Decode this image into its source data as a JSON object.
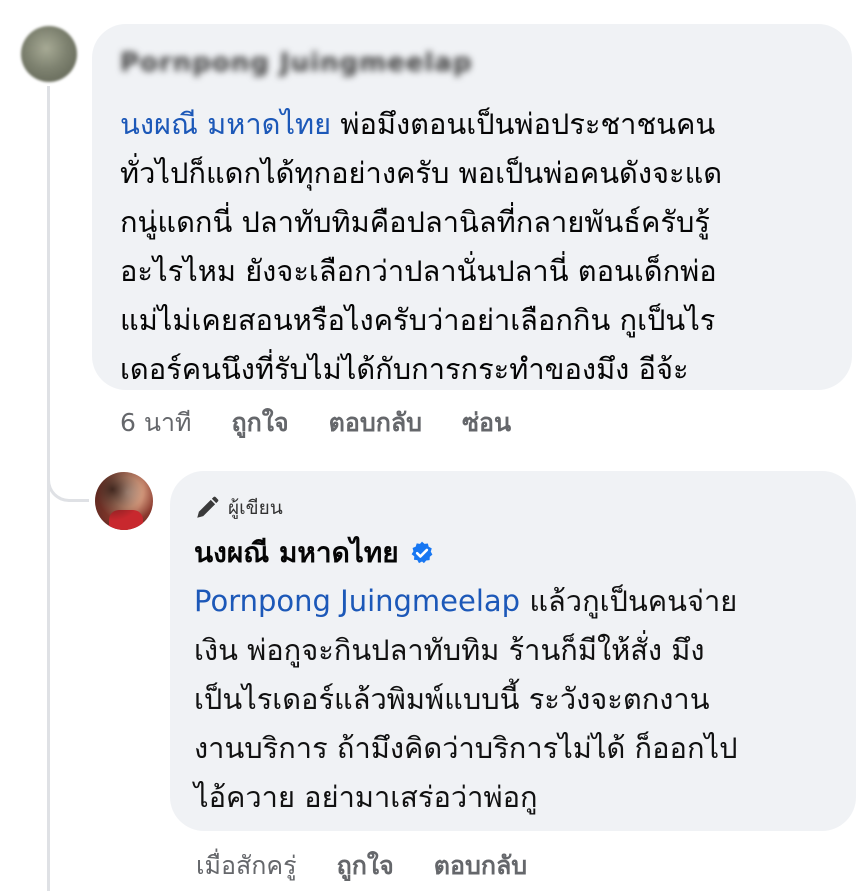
{
  "comment": {
    "author_name": "Pornpong Juingmeelap",
    "mention": "นงผณี มหาดไทย",
    "text_lines": [
      " พ่อมึงตอนเป็นพ่อประชาชนคน",
      "ทั่วไปก็แดกได้ทุกอย่างครับ พอเป็นพ่อคนดังจะแด",
      "กนู่แดกนี่ ปลาทับทิมคือปลานิลที่กลายพันธ์ครับรู้",
      "อะไรไหม ยังจะเลือกว่าปลานั่นปลานี่ ตอนเด็กพ่อ",
      "แม่ไม่เคยสอนหรือไงครับว่าอย่าเลือกกิน กูเป็นไร",
      "เดอร์คนนึงที่รับไม่ได้กับการกระทำของมึง อีจ้ะ"
    ],
    "actions": {
      "time": "6 นาที",
      "like": "ถูกใจ",
      "reply": "ตอบกลับ",
      "hide": "ซ่อน"
    }
  },
  "reply": {
    "badge_label": "ผู้เขียน",
    "author_name": "นงผณี มหาดไทย",
    "mention": "Pornpong Juingmeelap",
    "text_lines": [
      " แล้วกูเป็นคนจ่าย",
      "เงิน พ่อกูจะกินปลาทับทิม ร้านก็มีให้สั่ง มึง",
      "เป็นไรเดอร์แล้วพิมพ์แบบนี้ ระวังจะตกงาน",
      "งานบริการ ถ้ามึงคิดว่าบริการไม่ได้ ก็ออกไป",
      "ไอ้ควาย อย่ามาเสร่อว่าพ่อกู"
    ],
    "actions": {
      "time": "เมื่อสักครู่",
      "like": "ถูกใจ",
      "reply": "ตอบกลับ"
    }
  },
  "icons": {
    "pen": "pen-icon",
    "verified": "verified-badge-icon"
  },
  "colors": {
    "bubble": "#f0f2f5",
    "mention": "#1c58b8",
    "verified": "#1877f2",
    "meta": "#65676b"
  }
}
